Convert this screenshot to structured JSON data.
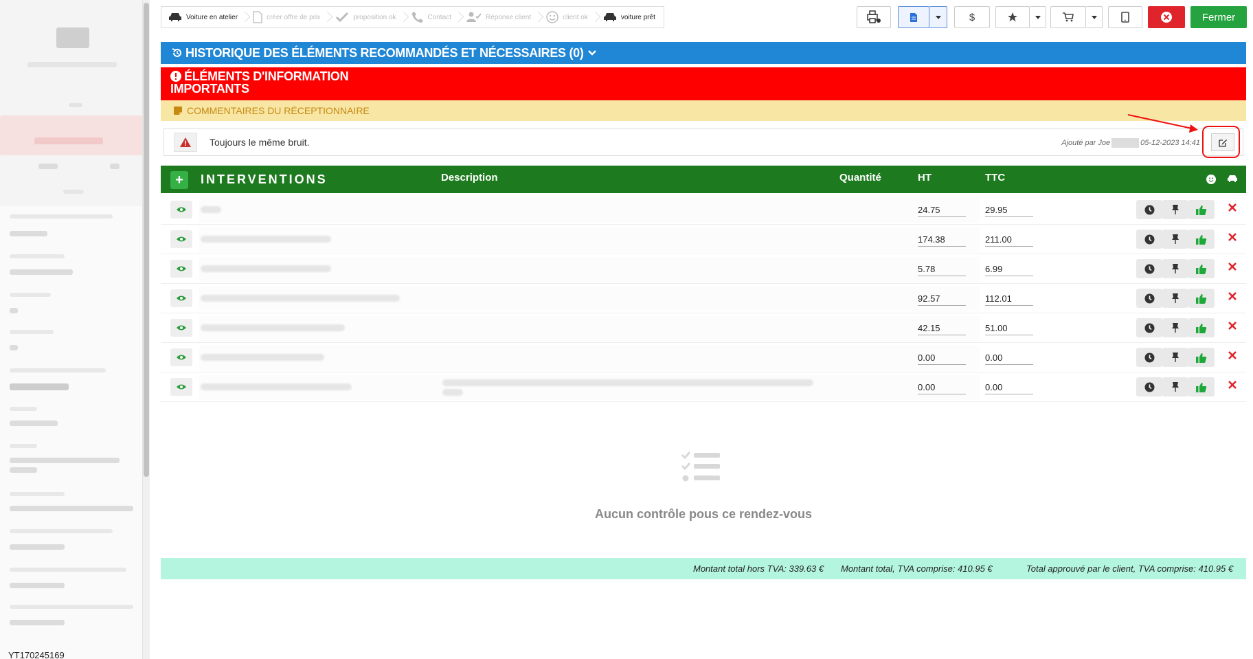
{
  "sidebar": {
    "record_id": "YT170245169"
  },
  "steps": [
    {
      "label": "Voiture en atelier",
      "icon": "car-icon",
      "active": true
    },
    {
      "label": "créer offre de prix",
      "icon": "document-icon",
      "active": false
    },
    {
      "label": "proposition ok",
      "icon": "check-icon",
      "active": false
    },
    {
      "label": "Contact",
      "icon": "phone-icon",
      "active": false
    },
    {
      "label": "Réponse client",
      "icon": "user-check-icon",
      "active": false
    },
    {
      "label": "client ok",
      "icon": "smile-icon",
      "active": false
    },
    {
      "label": "voiture prêt",
      "icon": "car-icon",
      "active": true
    }
  ],
  "toolbar": {
    "price_symbol": "$",
    "close_label": "Fermer",
    "accent_green": "#24a33e",
    "accent_red": "#e0242b"
  },
  "history": {
    "title": "HISTORIQUE DES ÉLÉMENTS RECOMMANDÉS ET NÉCESSAIRES (0)"
  },
  "info": {
    "title_line1": "ÉLÉMENTS D'INFORMATION",
    "title_line2": "IMPORTANTS"
  },
  "comments": {
    "section_title": "COMMENTAIRES DU RÉCEPTIONNAIRE",
    "text": "Toujours le même bruit.",
    "meta_prefix": "Ajouté par Joe",
    "meta_date": "05-12-2023 14:41"
  },
  "interventions": {
    "title": "INTERVENTIONS",
    "columns": {
      "description": "Description",
      "quantity": "Quantité",
      "ht": "HT",
      "ttc": "TTC"
    },
    "rows": [
      {
        "ht": "24.75",
        "ttc": "29.95"
      },
      {
        "ht": "174.38",
        "ttc": "211.00"
      },
      {
        "ht": "5.78",
        "ttc": "6.99"
      },
      {
        "ht": "92.57",
        "ttc": "112.01"
      },
      {
        "ht": "42.15",
        "ttc": "51.00"
      },
      {
        "ht": "0.00",
        "ttc": "0.00"
      },
      {
        "ht": "0.00",
        "ttc": "0.00"
      }
    ]
  },
  "checks": {
    "empty_text": "Aucun contrôle pous ce rendez-vous"
  },
  "totals": {
    "excl_vat": "Montant total hors TVA: 339.63 €",
    "incl_vat": "Montant total, TVA comprise: 410.95 €",
    "approved": "Total approuvé par le client, TVA comprise: 410.95 €"
  }
}
